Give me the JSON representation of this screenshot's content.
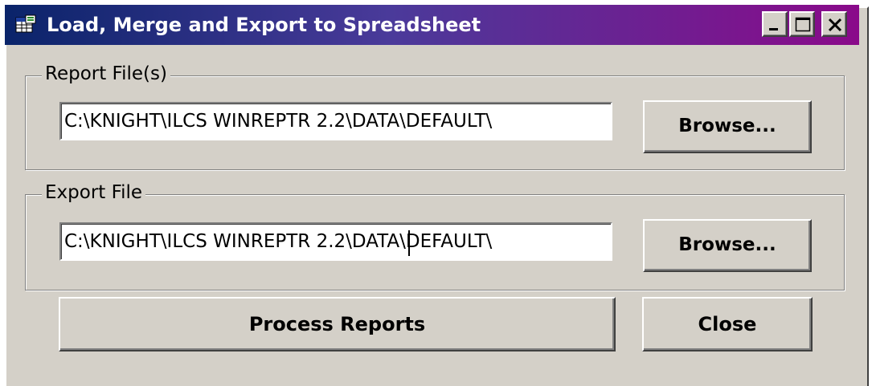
{
  "window": {
    "title": "Load, Merge and Export to Spreadsheet",
    "icon": "spreadsheet-window-icon",
    "controls": {
      "minimize_icon": "minimize-icon",
      "maximize_icon": "maximize-icon",
      "close_icon": "close-icon"
    },
    "colors": {
      "title_gradient_start": "#0a246a",
      "title_gradient_end": "#8a0a8a",
      "face": "#d4d0c8"
    }
  },
  "report_group": {
    "label": "Report File(s)",
    "path_value": "C:\\KNIGHT\\ILCS WINREPTR 2.2\\DATA\\DEFAULT\\",
    "browse_label": "Browse..."
  },
  "export_group": {
    "label": "Export File",
    "path_value": "C:\\KNIGHT\\ILCS WINREPTR 2.2\\DATA\\DEFAULT\\",
    "browse_label": "Browse..."
  },
  "actions": {
    "process_label": "Process Reports",
    "close_label": "Close"
  }
}
